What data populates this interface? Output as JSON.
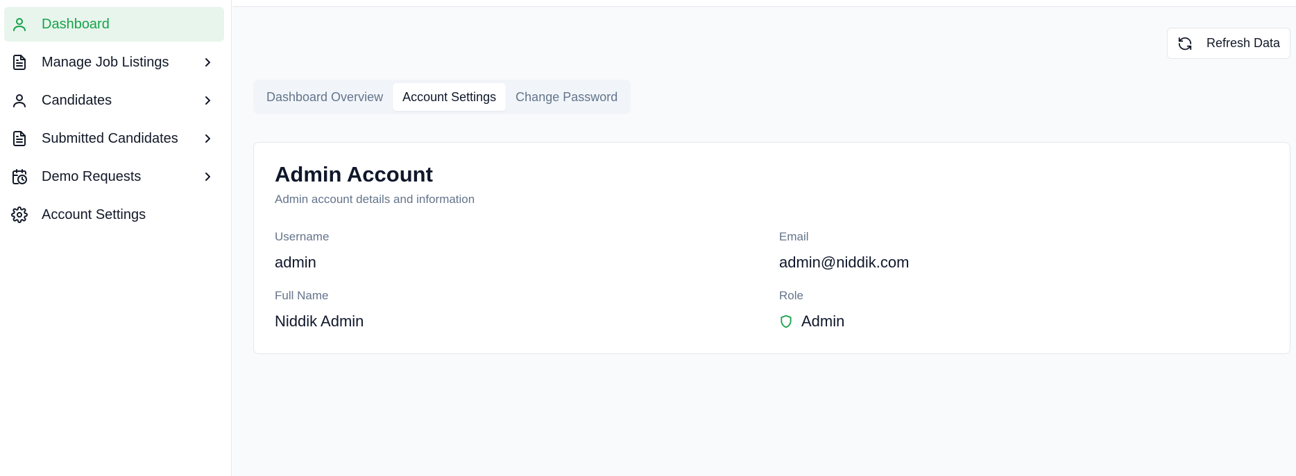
{
  "sidebar": {
    "items": [
      {
        "label": "Dashboard",
        "icon": "user-icon"
      },
      {
        "label": "Manage Job Listings",
        "icon": "document-icon"
      },
      {
        "label": "Candidates",
        "icon": "user-icon"
      },
      {
        "label": "Submitted Candidates",
        "icon": "document-icon"
      },
      {
        "label": "Demo Requests",
        "icon": "calendar-clock-icon"
      },
      {
        "label": "Account Settings",
        "icon": "gear-icon"
      }
    ],
    "active_color": "#16a34a"
  },
  "header": {
    "refresh_label": "Refresh Data"
  },
  "tabs": [
    {
      "label": "Dashboard Overview"
    },
    {
      "label": "Account Settings"
    },
    {
      "label": "Change Password"
    }
  ],
  "card": {
    "title": "Admin Account",
    "subtitle": "Admin account details and information",
    "fields": {
      "username": {
        "label": "Username",
        "value": "admin"
      },
      "email": {
        "label": "Email",
        "value": "admin@niddik.com"
      },
      "full_name": {
        "label": "Full Name",
        "value": "Niddik Admin"
      },
      "role": {
        "label": "Role",
        "value": "Admin",
        "icon": "shield-icon"
      }
    }
  }
}
